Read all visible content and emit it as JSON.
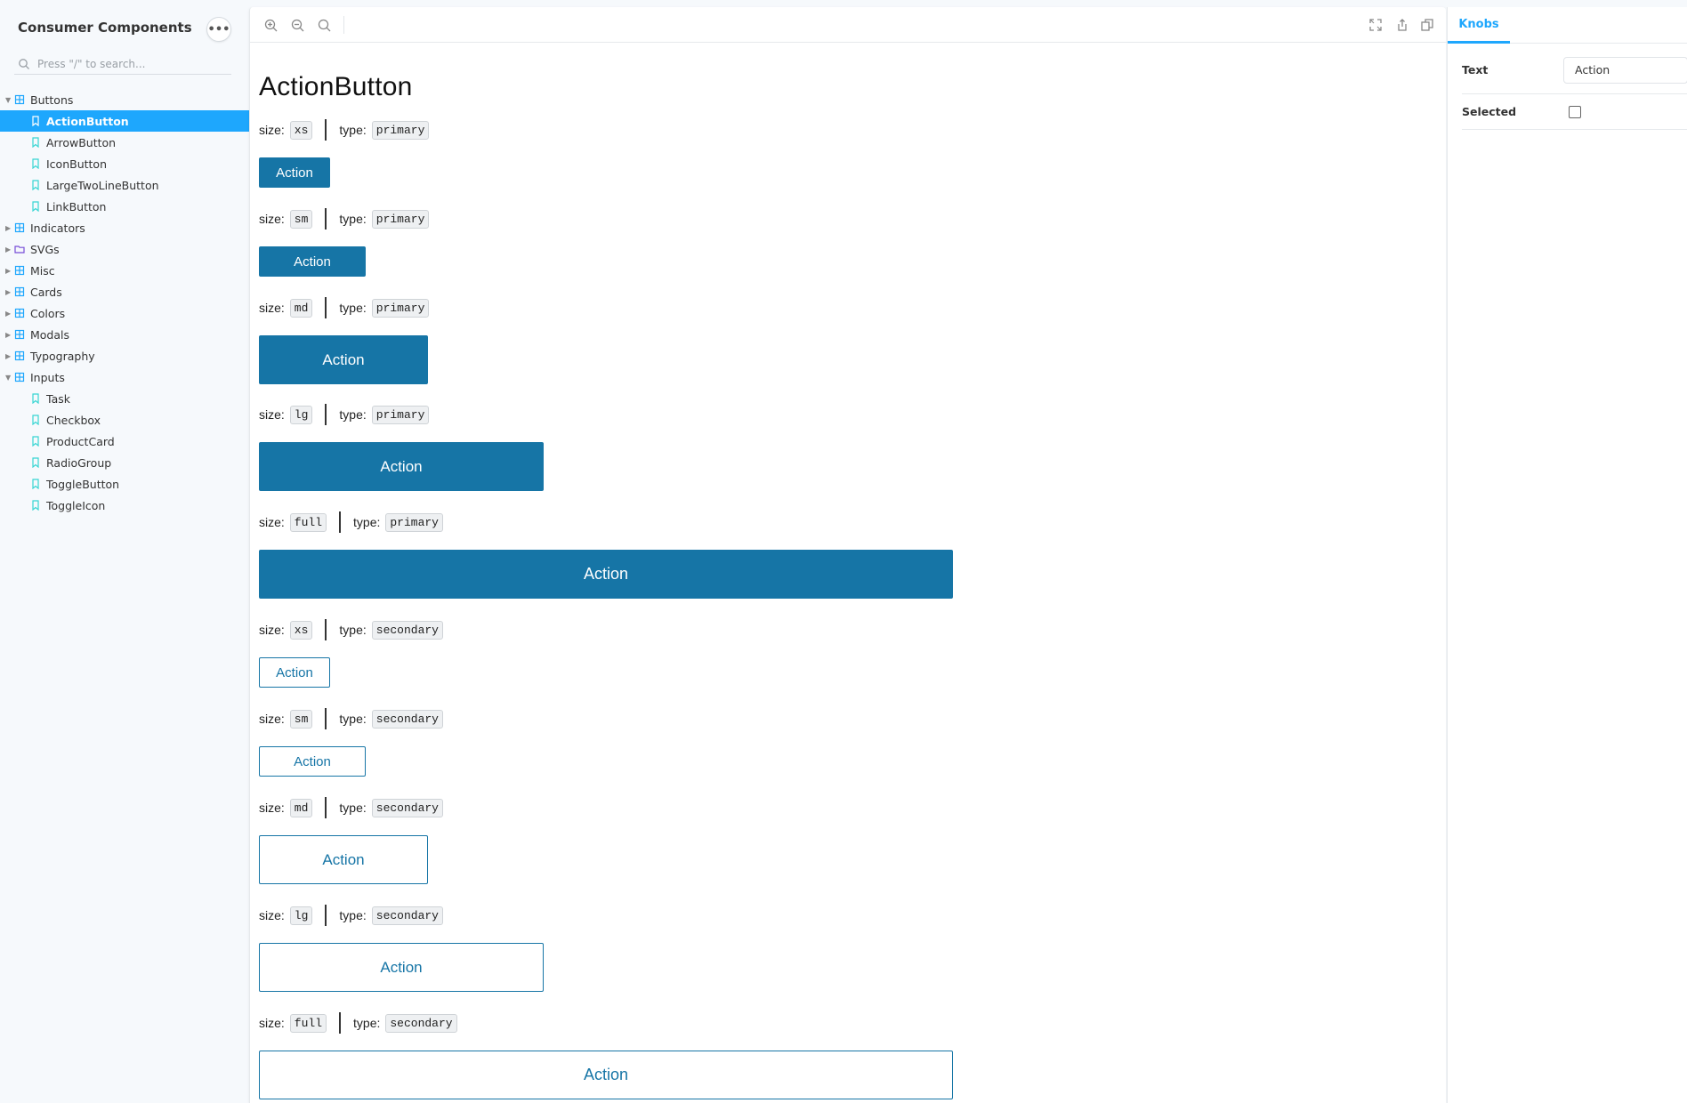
{
  "sidebar": {
    "brand": "Consumer Components",
    "search_placeholder": "Press \"/\" to search...",
    "tree": [
      {
        "kind": "group",
        "label": "Buttons",
        "expanded": true,
        "icon": "component-icon"
      },
      {
        "kind": "story",
        "label": "ActionButton",
        "selected": true,
        "icon": "bookmark-icon"
      },
      {
        "kind": "story",
        "label": "ArrowButton",
        "icon": "bookmark-icon"
      },
      {
        "kind": "story",
        "label": "IconButton",
        "icon": "bookmark-icon"
      },
      {
        "kind": "story",
        "label": "LargeTwoLineButton",
        "icon": "bookmark-icon"
      },
      {
        "kind": "story",
        "label": "LinkButton",
        "icon": "bookmark-icon"
      },
      {
        "kind": "group",
        "label": "Indicators",
        "expanded": false,
        "icon": "component-icon"
      },
      {
        "kind": "group",
        "label": "SVGs",
        "expanded": false,
        "icon": "folder-icon"
      },
      {
        "kind": "group",
        "label": "Misc",
        "expanded": false,
        "icon": "component-icon"
      },
      {
        "kind": "group",
        "label": "Cards",
        "expanded": false,
        "icon": "component-icon"
      },
      {
        "kind": "group",
        "label": "Colors",
        "expanded": false,
        "icon": "component-icon"
      },
      {
        "kind": "group",
        "label": "Modals",
        "expanded": false,
        "icon": "component-icon"
      },
      {
        "kind": "group",
        "label": "Typography",
        "expanded": false,
        "icon": "component-icon"
      },
      {
        "kind": "group",
        "label": "Inputs",
        "expanded": true,
        "icon": "component-icon"
      },
      {
        "kind": "story",
        "label": "Task",
        "icon": "bookmark-icon"
      },
      {
        "kind": "story",
        "label": "Checkbox",
        "icon": "bookmark-icon"
      },
      {
        "kind": "story",
        "label": "ProductCard",
        "icon": "bookmark-icon"
      },
      {
        "kind": "story",
        "label": "RadioGroup",
        "icon": "bookmark-icon"
      },
      {
        "kind": "story",
        "label": "ToggleButton",
        "icon": "bookmark-icon"
      },
      {
        "kind": "story",
        "label": "ToggleIcon",
        "icon": "bookmark-icon"
      }
    ]
  },
  "toolbar": {
    "left_icons": [
      "zoom-in-icon",
      "zoom-out-icon",
      "zoom-reset-icon"
    ],
    "right_icons": [
      "fullscreen-icon",
      "share-icon",
      "copy-icon"
    ]
  },
  "main": {
    "title": "ActionButton",
    "size_label": "size:",
    "type_label": "type:",
    "variants": [
      {
        "size": "xs",
        "type": "primary",
        "button_label": "Action"
      },
      {
        "size": "sm",
        "type": "primary",
        "button_label": "Action"
      },
      {
        "size": "md",
        "type": "primary",
        "button_label": "Action"
      },
      {
        "size": "lg",
        "type": "primary",
        "button_label": "Action"
      },
      {
        "size": "full",
        "type": "primary",
        "button_label": "Action"
      },
      {
        "size": "xs",
        "type": "secondary",
        "button_label": "Action"
      },
      {
        "size": "sm",
        "type": "secondary",
        "button_label": "Action"
      },
      {
        "size": "md",
        "type": "secondary",
        "button_label": "Action"
      },
      {
        "size": "lg",
        "type": "secondary",
        "button_label": "Action"
      },
      {
        "size": "full",
        "type": "secondary",
        "button_label": "Action"
      }
    ]
  },
  "knobs": {
    "tab_label": "Knobs",
    "text_label": "Text",
    "text_value": "Action",
    "selected_label": "Selected",
    "selected_checked": false
  },
  "colors": {
    "accent": "#1ea7fd",
    "button_primary": "#1675a6"
  }
}
